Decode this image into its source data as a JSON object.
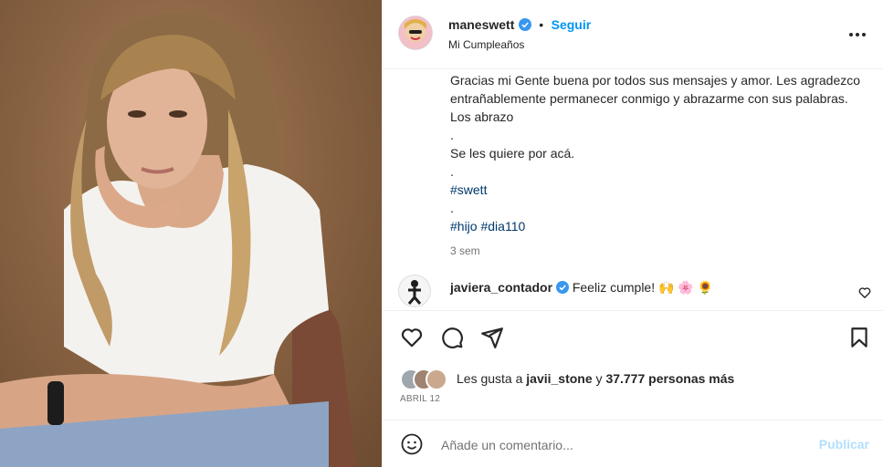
{
  "post": {
    "author": "maneswett",
    "separator": "•",
    "follow_label": "Seguir",
    "subtitle": "Mi Cumpleaños",
    "more_icon": "more-horizontal-icon"
  },
  "caption": {
    "lines": [
      "Gracias mi Gente buena por todos sus mensajes y amor. Les agradezco entrañablemente permanecer conmigo y abrazarme con sus palabras. Los abrazo",
      ".",
      "Se les quiere por acá.",
      "."
    ],
    "hashtag1": "#swett",
    "dot3": ".",
    "hashtag2": "#hijo",
    "hashtag3": "#dia110",
    "time": "3 sem"
  },
  "comments": [
    {
      "user": "javiera_contador",
      "text": "Feeliz cumple! 🙌 🌸 🌻"
    }
  ],
  "likes": {
    "prefix": "Les gusta a",
    "user": "javii_stone",
    "conj": "y",
    "count_text": "37.777 personas más",
    "date": "ABRIL 12"
  },
  "comment_box": {
    "placeholder": "Añade un comentario...",
    "publish_label": "Publicar"
  },
  "colors": {
    "accent": "#0095f6",
    "hashtag": "#00376b",
    "verified": "#3897f0"
  }
}
